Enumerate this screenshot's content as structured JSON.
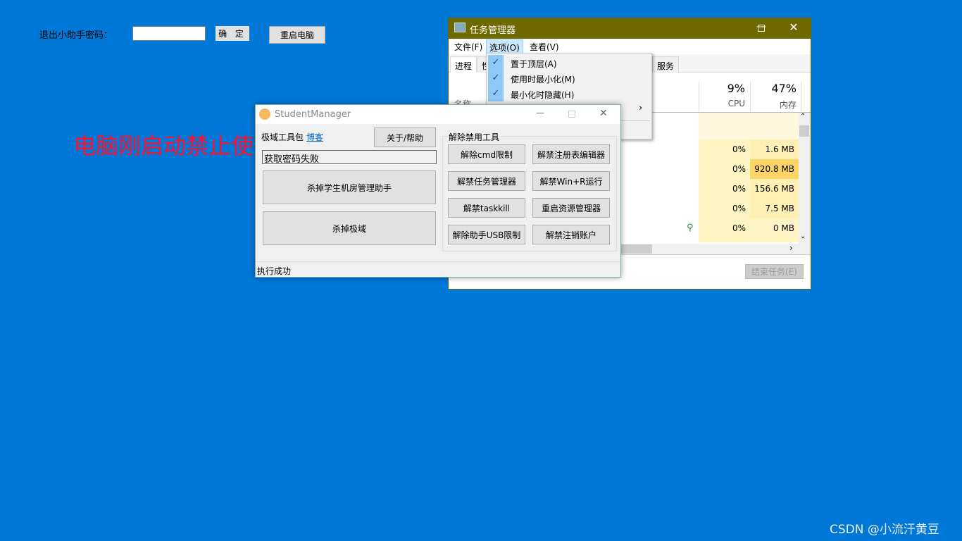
{
  "desktop": {
    "password_label": "退出小助手密码：",
    "password_value": "",
    "confirm_button": "确 定",
    "reboot_button": "重启电脑",
    "banner": "电脑刚启动禁止使"
  },
  "task_manager": {
    "title": "任务管理器",
    "menu": [
      "文件(F)",
      "选项(O)",
      "查看(V)"
    ],
    "tabs": [
      "进程",
      "性",
      "服务"
    ],
    "name_header": "名称",
    "cpu": {
      "percent": "9%",
      "label": "CPU"
    },
    "memory": {
      "percent": "47%",
      "label": "内存"
    },
    "rows": [
      {
        "cpu": "0%",
        "mem": "1.6 MB"
      },
      {
        "cpu": "0%",
        "mem": "920.8 MB"
      },
      {
        "cpu": "0%",
        "mem": "156.6 MB"
      },
      {
        "cpu": "0%",
        "mem": "7.5 MB"
      },
      {
        "cpu": "0%",
        "mem": "0 MB"
      }
    ],
    "end_task": "结束任务(E)",
    "options_menu": [
      {
        "label": "置于顶层(A)",
        "checked": true
      },
      {
        "label": "使用时最小化(M)",
        "checked": true
      },
      {
        "label": "最小化时隐藏(H)",
        "checked": true
      }
    ],
    "accent": "#6f6a00"
  },
  "student_manager": {
    "title": "StudentManager",
    "toolkit_label": "极域工具包",
    "blog_link": "博客",
    "about_button": "关于/帮助",
    "password_field": "获取密码失败",
    "kill_helper": "杀掉学生机房管理助手",
    "kill_jiyu": "杀掉极域",
    "group_title": "解除禁用工具",
    "tools": [
      "解除cmd限制",
      "解禁注册表编辑器",
      "解禁任务管理器",
      "解禁Win+R运行",
      "解禁taskkill",
      "重启资源管理器",
      "解除助手USB限制",
      "解禁注销账户"
    ],
    "status": "执行成功"
  },
  "watermark": "CSDN @小流汗黄豆"
}
